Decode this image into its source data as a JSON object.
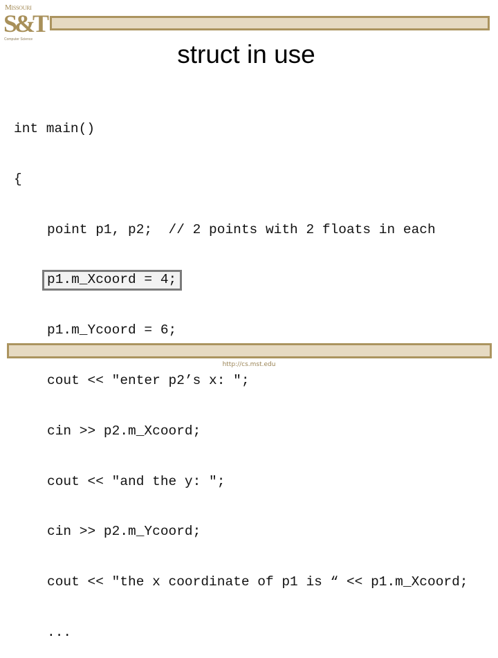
{
  "logo": {
    "top_text": "Missouri",
    "mark": "S&T",
    "subtitle": "Computer Science"
  },
  "colors": {
    "brand_gold": "#ab945f",
    "bar_fill": "#e6dac2",
    "highlight_border": "#7a7a7a"
  },
  "slide": {
    "title": "struct in use",
    "code_lines": [
      {
        "text": "int main()",
        "indent": false,
        "highlight": false
      },
      {
        "text": "{",
        "indent": false,
        "highlight": false
      },
      {
        "text": "point p1, p2;  // 2 points with 2 floats in each",
        "indent": true,
        "highlight": false
      },
      {
        "text": "p1.m_Xcoord = 4;",
        "indent": true,
        "highlight": true
      },
      {
        "text": "p1.m_Ycoord = 6;",
        "indent": true,
        "highlight": false
      },
      {
        "text": "cout << \"enter p2’s x: \";",
        "indent": true,
        "highlight": false
      },
      {
        "text": "cin >> p2.m_Xcoord;",
        "indent": true,
        "highlight": false
      },
      {
        "text": "cout << \"and the y: \";",
        "indent": true,
        "highlight": false
      },
      {
        "text": "cin >> p2.m_Ycoord;",
        "indent": true,
        "highlight": false
      },
      {
        "text": "cout << \"the x coordinate of p1 is “ << p1.m_Xcoord;",
        "indent": true,
        "highlight": false
      },
      {
        "text": "...",
        "indent": true,
        "highlight": false
      }
    ],
    "footer_url": "http://cs.mst.edu"
  }
}
